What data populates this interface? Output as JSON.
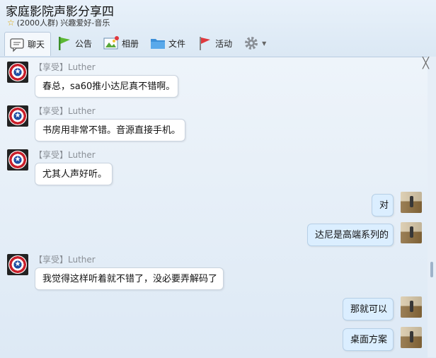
{
  "window": {
    "title": "家庭影院声影分享四",
    "member_count": "(2000人群)",
    "category": "兴趣爱好-音乐"
  },
  "toolbar": {
    "tabs": [
      {
        "label": "聊天",
        "icon": "chat-bubble-icon",
        "active": true
      },
      {
        "label": "公告",
        "icon": "flag-icon"
      },
      {
        "label": "相册",
        "icon": "photo-album-icon"
      },
      {
        "label": "文件",
        "icon": "folder-icon"
      },
      {
        "label": "活动",
        "icon": "activity-flag-icon"
      }
    ],
    "settings_icon": "gear-icon"
  },
  "close_label": "╳",
  "messages": [
    {
      "sender": "【享受】Luther",
      "text": "春总，sa60推小达尼真不错啊。",
      "side": "left"
    },
    {
      "sender": "【享受】Luther",
      "text": "书房用非常不错。音源直接手机。",
      "side": "left"
    },
    {
      "sender": "【享受】Luther",
      "text": "尤其人声好听。",
      "side": "left"
    },
    {
      "text": "对",
      "side": "right"
    },
    {
      "text": "达尼是高端系列的",
      "side": "right"
    },
    {
      "sender": "【享受】Luther",
      "text": "我觉得这样听着就不错了，没必要弄解码了",
      "side": "left"
    },
    {
      "text": "那就可以",
      "side": "right"
    },
    {
      "text": "桌面方案",
      "side": "right"
    }
  ],
  "colors": {
    "accent": "#4a90d9",
    "bubble_self": "#dbeeff",
    "bubble_other": "#ffffff",
    "sender_name": "#8a8f96"
  }
}
